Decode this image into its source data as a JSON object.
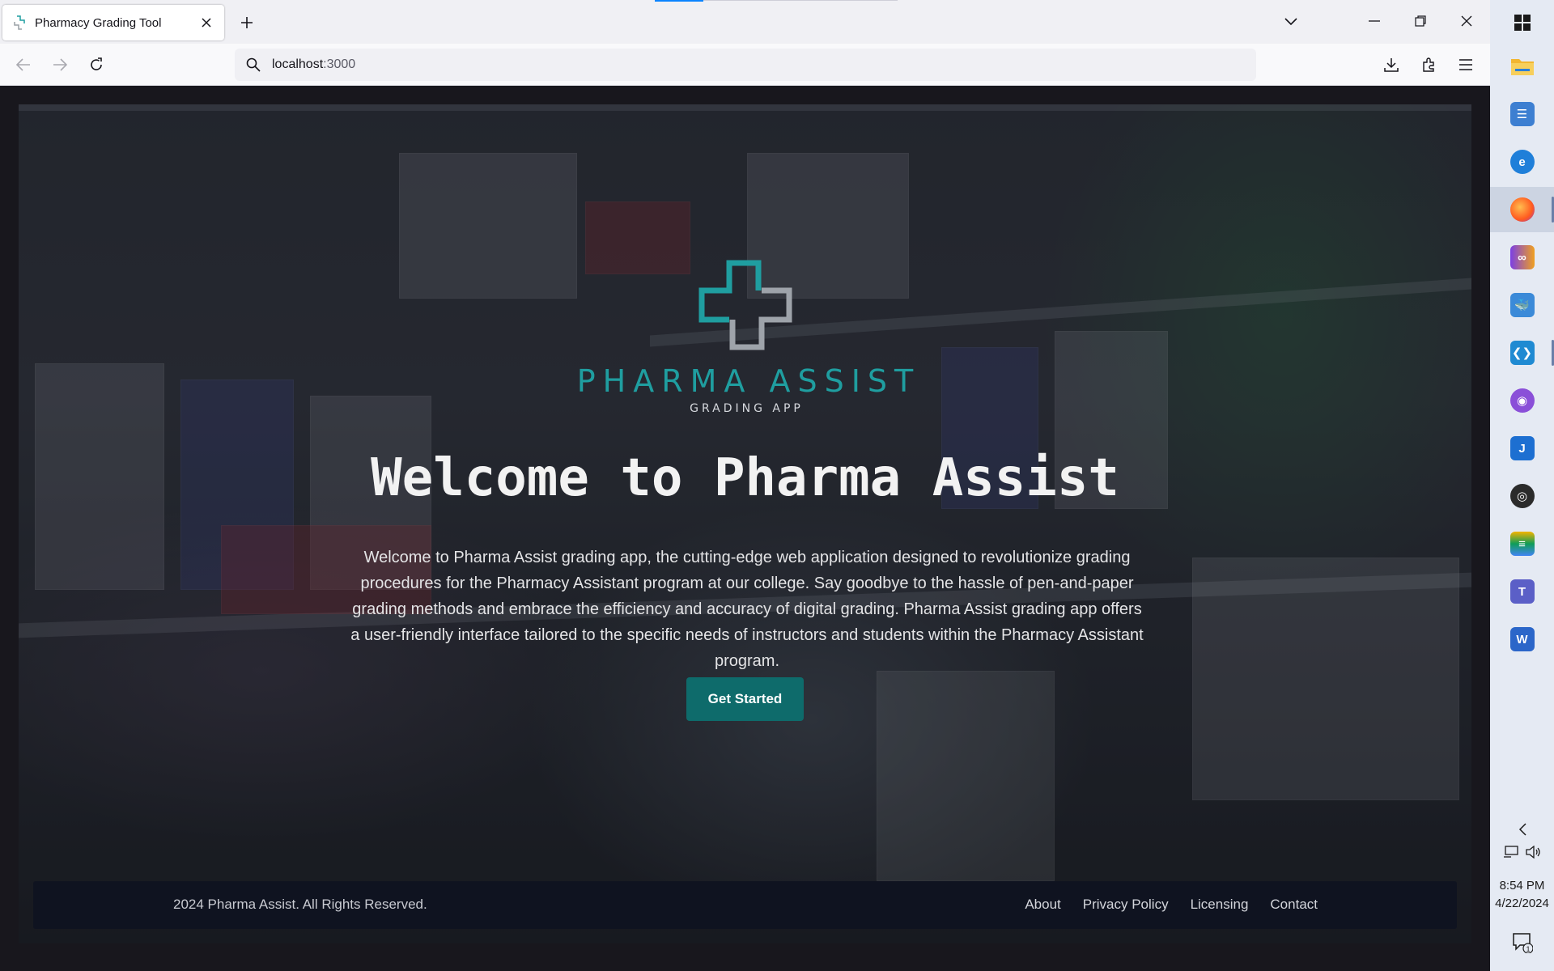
{
  "browser": {
    "tab_title": "Pharmacy Grading Tool",
    "url_host": "localhost",
    "url_port": ":3000",
    "icons": [
      "new-tab-icon",
      "list-all-tabs-icon",
      "minimize-icon",
      "restore-icon",
      "close-icon",
      "back-icon",
      "forward-icon",
      "reload-icon",
      "search-icon",
      "downloads-icon",
      "extensions-icon",
      "menu-icon"
    ]
  },
  "page": {
    "logo_brand": "PHARMA ASSIST",
    "logo_sub": "GRADING APP",
    "headline": "Welcome to Pharma Assist",
    "intro": "Welcome to Pharma Assist grading app, the cutting-edge web application designed to revolutionize grading procedures for the Pharmacy Assistant program at our college. Say goodbye to the hassle of pen-and-paper grading methods and embrace the efficiency and accuracy of digital grading. Pharma Assist grading app offers a user-friendly interface tailored to the specific needs of instructors and students within the Pharmacy Assistant program.",
    "cta_label": "Get Started",
    "accent_color": "#0e6b6b",
    "brand_color": "#1f9ea0"
  },
  "footer": {
    "copyright": "2024 Pharma Assist. All Rights Reserved.",
    "links": [
      "About",
      "Privacy Policy",
      "Licensing",
      "Contact"
    ]
  },
  "taskbar": {
    "apps": [
      "windows-start",
      "file-explorer",
      "control-panel",
      "edge-dev",
      "firefox",
      "proton-app",
      "docker-desktop",
      "vs-code",
      "github-desktop",
      "jitsi-app",
      "obs-studio",
      "layers-app",
      "teams-new",
      "word"
    ],
    "time": "8:54 PM",
    "date": "4/22/2024",
    "notification_count": "1"
  }
}
